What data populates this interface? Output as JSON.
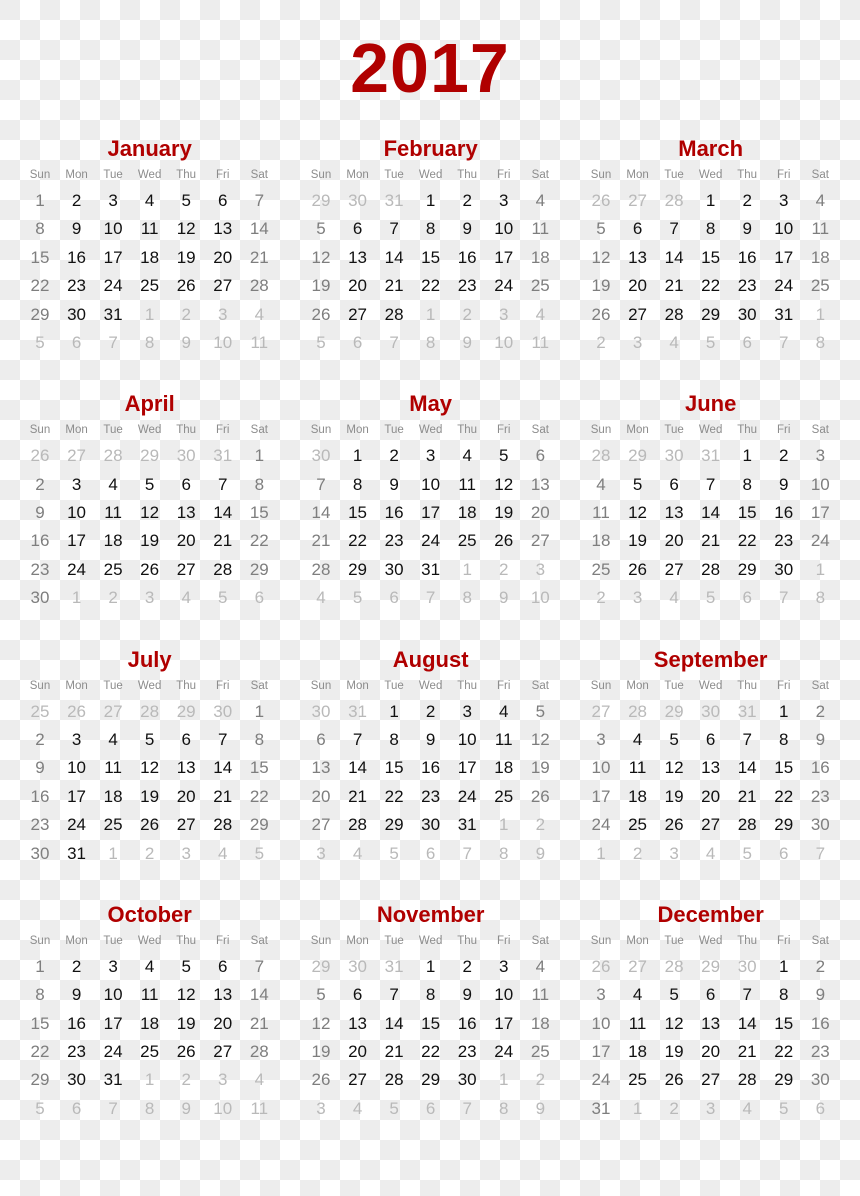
{
  "year": "2017",
  "weekday_labels": [
    "Sun",
    "Mon",
    "Tue",
    "Wed",
    "Thu",
    "Fri",
    "Sat"
  ],
  "colors": {
    "title": "#b00000",
    "weekday_text": "#111111",
    "weekend_text": "#7e7e7e",
    "other_month_text": "#b9b9b9",
    "header_text": "#8c8c8c"
  },
  "months": [
    {
      "name": "January",
      "weeks": [
        [
          1,
          2,
          3,
          4,
          5,
          6,
          7
        ],
        [
          8,
          9,
          10,
          11,
          12,
          13,
          14
        ],
        [
          15,
          16,
          17,
          18,
          19,
          20,
          21
        ],
        [
          22,
          23,
          24,
          25,
          26,
          27,
          28
        ],
        [
          29,
          30,
          31,
          1,
          2,
          3,
          4
        ],
        [
          5,
          6,
          7,
          8,
          9,
          10,
          11
        ]
      ],
      "first_index": 0,
      "days_in_month": 31
    },
    {
      "name": "February",
      "weeks": [
        [
          29,
          30,
          31,
          1,
          2,
          3,
          4
        ],
        [
          5,
          6,
          7,
          8,
          9,
          10,
          11
        ],
        [
          12,
          13,
          14,
          15,
          16,
          17,
          18
        ],
        [
          19,
          20,
          21,
          22,
          23,
          24,
          25
        ],
        [
          26,
          27,
          28,
          1,
          2,
          3,
          4
        ],
        [
          5,
          6,
          7,
          8,
          9,
          10,
          11
        ]
      ],
      "first_index": 3,
      "days_in_month": 28
    },
    {
      "name": "March",
      "weeks": [
        [
          26,
          27,
          28,
          1,
          2,
          3,
          4
        ],
        [
          5,
          6,
          7,
          8,
          9,
          10,
          11
        ],
        [
          12,
          13,
          14,
          15,
          16,
          17,
          18
        ],
        [
          19,
          20,
          21,
          22,
          23,
          24,
          25
        ],
        [
          26,
          27,
          28,
          29,
          30,
          31,
          1
        ],
        [
          2,
          3,
          4,
          5,
          6,
          7,
          8
        ]
      ],
      "first_index": 3,
      "days_in_month": 31
    },
    {
      "name": "April",
      "weeks": [
        [
          26,
          27,
          28,
          29,
          30,
          31,
          1
        ],
        [
          2,
          3,
          4,
          5,
          6,
          7,
          8
        ],
        [
          9,
          10,
          11,
          12,
          13,
          14,
          15
        ],
        [
          16,
          17,
          18,
          19,
          20,
          21,
          22
        ],
        [
          23,
          24,
          25,
          26,
          27,
          28,
          29
        ],
        [
          30,
          1,
          2,
          3,
          4,
          5,
          6
        ]
      ],
      "first_index": 6,
      "days_in_month": 30
    },
    {
      "name": "May",
      "weeks": [
        [
          30,
          1,
          2,
          3,
          4,
          5,
          6
        ],
        [
          7,
          8,
          9,
          10,
          11,
          12,
          13
        ],
        [
          14,
          15,
          16,
          17,
          18,
          19,
          20
        ],
        [
          21,
          22,
          23,
          24,
          25,
          26,
          27
        ],
        [
          28,
          29,
          30,
          31,
          1,
          2,
          3
        ],
        [
          4,
          5,
          6,
          7,
          8,
          9,
          10
        ]
      ],
      "first_index": 1,
      "days_in_month": 31
    },
    {
      "name": "June",
      "weeks": [
        [
          28,
          29,
          30,
          31,
          1,
          2,
          3
        ],
        [
          4,
          5,
          6,
          7,
          8,
          9,
          10
        ],
        [
          11,
          12,
          13,
          14,
          15,
          16,
          17
        ],
        [
          18,
          19,
          20,
          21,
          22,
          23,
          24
        ],
        [
          25,
          26,
          27,
          28,
          29,
          30,
          1
        ],
        [
          2,
          3,
          4,
          5,
          6,
          7,
          8
        ]
      ],
      "first_index": 4,
      "days_in_month": 30
    },
    {
      "name": "July",
      "weeks": [
        [
          25,
          26,
          27,
          28,
          29,
          30,
          1
        ],
        [
          2,
          3,
          4,
          5,
          6,
          7,
          8
        ],
        [
          9,
          10,
          11,
          12,
          13,
          14,
          15
        ],
        [
          16,
          17,
          18,
          19,
          20,
          21,
          22
        ],
        [
          23,
          24,
          25,
          26,
          27,
          28,
          29
        ],
        [
          30,
          31,
          1,
          2,
          3,
          4,
          5
        ]
      ],
      "first_index": 6,
      "days_in_month": 31
    },
    {
      "name": "August",
      "weeks": [
        [
          30,
          31,
          1,
          2,
          3,
          4,
          5
        ],
        [
          6,
          7,
          8,
          9,
          10,
          11,
          12
        ],
        [
          13,
          14,
          15,
          16,
          17,
          18,
          19
        ],
        [
          20,
          21,
          22,
          23,
          24,
          25,
          26
        ],
        [
          27,
          28,
          29,
          30,
          31,
          1,
          2
        ],
        [
          3,
          4,
          5,
          6,
          7,
          8,
          9
        ]
      ],
      "first_index": 2,
      "days_in_month": 31
    },
    {
      "name": "September",
      "weeks": [
        [
          27,
          28,
          29,
          30,
          31,
          1,
          2
        ],
        [
          3,
          4,
          5,
          6,
          7,
          8,
          9
        ],
        [
          10,
          11,
          12,
          13,
          14,
          15,
          16
        ],
        [
          17,
          18,
          19,
          20,
          21,
          22,
          23
        ],
        [
          24,
          25,
          26,
          27,
          28,
          29,
          30
        ],
        [
          1,
          2,
          3,
          4,
          5,
          6,
          7
        ]
      ],
      "first_index": 5,
      "days_in_month": 30
    },
    {
      "name": "October",
      "weeks": [
        [
          1,
          2,
          3,
          4,
          5,
          6,
          7
        ],
        [
          8,
          9,
          10,
          11,
          12,
          13,
          14
        ],
        [
          15,
          16,
          17,
          18,
          19,
          20,
          21
        ],
        [
          22,
          23,
          24,
          25,
          26,
          27,
          28
        ],
        [
          29,
          30,
          31,
          1,
          2,
          3,
          4
        ],
        [
          5,
          6,
          7,
          8,
          9,
          10,
          11
        ]
      ],
      "first_index": 0,
      "days_in_month": 31
    },
    {
      "name": "November",
      "weeks": [
        [
          29,
          30,
          31,
          1,
          2,
          3,
          4
        ],
        [
          5,
          6,
          7,
          8,
          9,
          10,
          11
        ],
        [
          12,
          13,
          14,
          15,
          16,
          17,
          18
        ],
        [
          19,
          20,
          21,
          22,
          23,
          24,
          25
        ],
        [
          26,
          27,
          28,
          29,
          30,
          1,
          2
        ],
        [
          3,
          4,
          5,
          6,
          7,
          8,
          9
        ]
      ],
      "first_index": 3,
      "days_in_month": 30
    },
    {
      "name": "December",
      "weeks": [
        [
          26,
          27,
          28,
          29,
          30,
          1,
          2
        ],
        [
          3,
          4,
          5,
          6,
          7,
          8,
          9
        ],
        [
          10,
          11,
          12,
          13,
          14,
          15,
          16
        ],
        [
          17,
          18,
          19,
          20,
          21,
          22,
          23
        ],
        [
          24,
          25,
          26,
          27,
          28,
          29,
          30
        ],
        [
          31,
          1,
          2,
          3,
          4,
          5,
          6
        ]
      ],
      "first_index": 5,
      "days_in_month": 31
    }
  ]
}
